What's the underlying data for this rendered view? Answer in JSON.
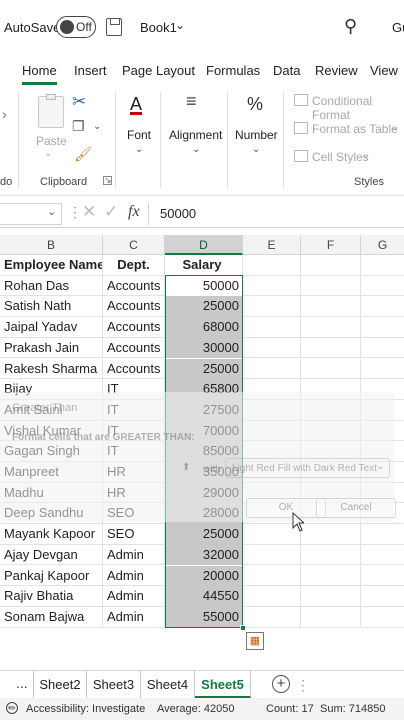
{
  "titlebar": {
    "autosave": "AutoSave",
    "toggle_state": "Off",
    "book": "Book1",
    "user": "Gu"
  },
  "tabs": [
    "Home",
    "Insert",
    "Page Layout",
    "Formulas",
    "Data",
    "Review",
    "View"
  ],
  "ribbon": {
    "left_cut": "do",
    "paste": "Paste",
    "clipboard": "Clipboard",
    "font": "Font",
    "alignment": "Alignment",
    "number": "Number",
    "conditional": "Conditional Format",
    "format_table": "Format as Table",
    "cell_styles": "Cell Styles",
    "styles": "Styles"
  },
  "formula": {
    "fx": "fx",
    "value": "50000"
  },
  "columns": [
    "B",
    "C",
    "D",
    "E",
    "F",
    "G"
  ],
  "headers": {
    "name": "Employee Name",
    "dept": "Dept.",
    "salary": "Salary"
  },
  "rows": [
    {
      "name": "Rohan Das",
      "dept": "Accounts",
      "salary": "50000"
    },
    {
      "name": "Satish Nath",
      "dept": "Accounts",
      "salary": "25000"
    },
    {
      "name": "Jaipal Yadav",
      "dept": "Accounts",
      "salary": "68000"
    },
    {
      "name": "Prakash Jain",
      "dept": "Accounts",
      "salary": "30000"
    },
    {
      "name": "Rakesh Sharma",
      "dept": "Accounts",
      "salary": "25000"
    },
    {
      "name": "Bijay",
      "dept": "IT",
      "salary": "65800"
    },
    {
      "name": "Amit Saini",
      "dept": "IT",
      "salary": "27500"
    },
    {
      "name": "Vishal Kumar",
      "dept": "IT",
      "salary": "70000"
    },
    {
      "name": "Gagan Singh",
      "dept": "IT",
      "salary": "85000"
    },
    {
      "name": "Manpreet",
      "dept": "HR",
      "salary": "35000"
    },
    {
      "name": "Madhu",
      "dept": "HR",
      "salary": "29000"
    },
    {
      "name": "Deep Sandhu",
      "dept": "SEO",
      "salary": "28000"
    },
    {
      "name": "Mayank Kapoor",
      "dept": "SEO",
      "salary": "25000"
    },
    {
      "name": "Ajay Devgan",
      "dept": "Admin",
      "salary": "32000"
    },
    {
      "name": "Pankaj Kapoor",
      "dept": "Admin",
      "salary": "20000"
    },
    {
      "name": "Rajiv Bhatia",
      "dept": "Admin",
      "salary": "44550"
    },
    {
      "name": "Sonam Bajwa",
      "dept": "Admin",
      "salary": "55000"
    }
  ],
  "dialog": {
    "title": "Greater Than",
    "prompt": "Format cells that are GREATER THAN:",
    "with": "with",
    "fill": "Light Red Fill with Dark Red Text",
    "ok": "OK",
    "cancel": "Cancel"
  },
  "sheets": {
    "more": "...",
    "tabs": [
      "Sheet2",
      "Sheet3",
      "Sheet4",
      "Sheet5"
    ],
    "active": "Sheet5"
  },
  "status": {
    "accessibility": "Accessibility: Investigate",
    "average": "Average: 42050",
    "count": "Count: 17",
    "sum": "Sum: 714850"
  },
  "colors": {
    "accent": "#107c41",
    "selection_fill": "#c8c8c8"
  }
}
